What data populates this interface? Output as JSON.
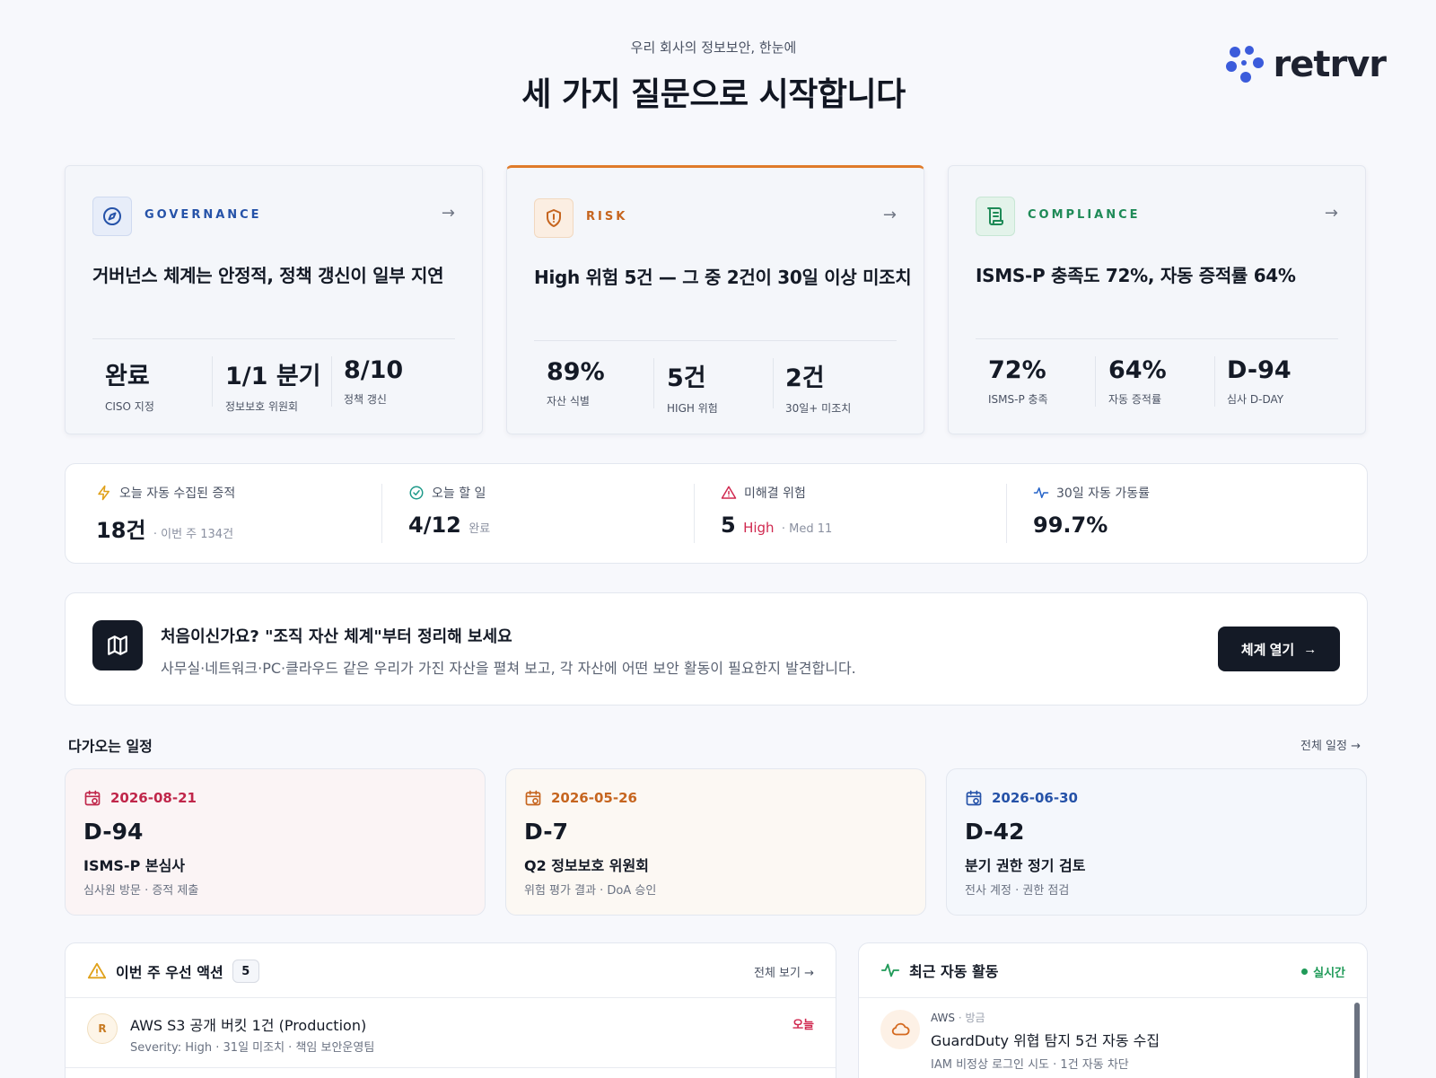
{
  "header": {
    "subtitle": "우리 회사의 정보보안, 한눈에",
    "title": "세 가지 질문으로 시작합니다",
    "logo_text": "retrvr"
  },
  "colors": {
    "governance": "#2552a8",
    "risk": "#c6651f",
    "compliance": "#1e8a57",
    "danger": "#d0284f",
    "live": "#1f9a58",
    "dark": "#141a26"
  },
  "cards": [
    {
      "key": "governance",
      "icon": "compass-icon",
      "label": "GOVERNANCE",
      "headline": "거버넌스 체계는 안정적, 정책 갱신이 일부 지연",
      "stats": [
        {
          "value": "완료",
          "label": "CISO 지정"
        },
        {
          "value": "1/1 분기",
          "label": "정보보호 위원회"
        },
        {
          "value": "8/10",
          "label": "정책 갱신"
        }
      ]
    },
    {
      "key": "risk",
      "icon": "shield-alert-icon",
      "label": "RISK",
      "headline": "High 위험 5건 — 그 중 2건이 30일 이상 미조치",
      "stats": [
        {
          "value": "89%",
          "label": "자산 식별"
        },
        {
          "value": "5건",
          "label": "HIGH 위험"
        },
        {
          "value": "2건",
          "label": "30일+ 미조치"
        }
      ]
    },
    {
      "key": "compliance",
      "icon": "scroll-icon",
      "label": "COMPLIANCE",
      "headline": "ISMS-P 충족도 72%, 자동 증적률 64%",
      "stats": [
        {
          "value": "72%",
          "label": "ISMS-P 충족"
        },
        {
          "value": "64%",
          "label": "자동 증적률"
        },
        {
          "value": "D-94",
          "label": "심사 D-DAY"
        }
      ]
    }
  ],
  "metrics": [
    {
      "icon": "lightning-icon",
      "label": "오늘 자동 수집된 증적",
      "value": "18건",
      "extra": "· 이번 주 134건"
    },
    {
      "icon": "check-circle-icon",
      "label": "오늘 할 일",
      "value": "4/12",
      "extra": "완료"
    },
    {
      "icon": "warning-icon",
      "label": "미해결 위험",
      "value": "5",
      "high": "High",
      "extra": "· Med 11"
    },
    {
      "icon": "pulse-icon",
      "label": "30일 자동 가동률",
      "value": "99.7%",
      "extra": ""
    }
  ],
  "banner": {
    "icon": "map-icon",
    "title": "처음이신가요? \"조직 자산 체계\"부터 정리해 보세요",
    "desc": "사무실·네트워크·PC·클라우드 같은 우리가 가진 자산을 펼쳐 보고, 각 자산에 어떤 보안 활동이 필요한지 발견합니다.",
    "button": "체계 열기"
  },
  "schedule": {
    "title": "다가오는 일정",
    "link": "전체 일정 →",
    "items": [
      {
        "date": "2026-08-21",
        "dday": "D-94",
        "title": "ISMS-P 본심사",
        "sub": "심사원 방문 · 증적 제출",
        "tone": "red"
      },
      {
        "date": "2026-05-26",
        "dday": "D-7",
        "title": "Q2 정보보호 위원회",
        "sub": "위험 평가 결과 · DoA 승인",
        "tone": "orange"
      },
      {
        "date": "2026-06-30",
        "dday": "D-42",
        "title": "분기 권한 정기 검토",
        "sub": "전사 계정 · 권한 점검",
        "tone": "blue"
      }
    ]
  },
  "actions": {
    "title": "이번 주 우선 액션",
    "count": "5",
    "link": "전체 보기 →",
    "items": [
      {
        "avatar": "R",
        "title": "AWS S3 공개 버킷 1건 (Production)",
        "sub": "Severity: High · 31일 미조치 · 책임 보안운영팀",
        "tag": "오늘"
      }
    ]
  },
  "activity": {
    "title": "최근 자동 활동",
    "live": "실시간",
    "items": [
      {
        "icon": "cloud-icon",
        "source": "AWS",
        "time": "· 방금",
        "title": "GuardDuty 위협 탐지 5건 자동 수집",
        "sub": "IAM 비정상 로그인 시도 · 1건 자동 차단"
      }
    ]
  }
}
